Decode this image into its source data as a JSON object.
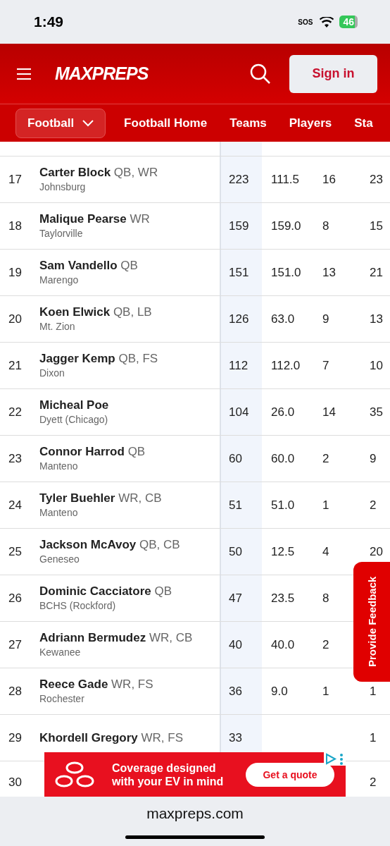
{
  "status_bar": {
    "time": "1:49",
    "sos": "SOS",
    "battery": "46"
  },
  "header": {
    "logo": "MAXPREPS",
    "sign_in": "Sign in"
  },
  "nav": {
    "sport": "Football",
    "links": [
      "Football Home",
      "Teams",
      "Players",
      "Sta"
    ]
  },
  "table": {
    "rows": [
      {
        "rank": "17",
        "name": "Carter Block",
        "positions": "QB, WR",
        "school": "Johnsburg",
        "column_1": "223",
        "column_2": "111.5",
        "column_3": "16",
        "column_4": "23"
      },
      {
        "rank": "18",
        "name": "Malique Pearse",
        "positions": "WR",
        "school": "Taylorville",
        "column_1": "159",
        "column_2": "159.0",
        "column_3": "8",
        "column_4": "15"
      },
      {
        "rank": "19",
        "name": "Sam Vandello",
        "positions": "QB",
        "school": "Marengo",
        "column_1": "151",
        "column_2": "151.0",
        "column_3": "13",
        "column_4": "21"
      },
      {
        "rank": "20",
        "name": "Koen Elwick",
        "positions": "QB, LB",
        "school": "Mt. Zion",
        "column_1": "126",
        "column_2": "63.0",
        "column_3": "9",
        "column_4": "13"
      },
      {
        "rank": "21",
        "name": "Jagger Kemp",
        "positions": "QB, FS",
        "school": "Dixon",
        "column_1": "112",
        "column_2": "112.0",
        "column_3": "7",
        "column_4": "10"
      },
      {
        "rank": "22",
        "name": "Micheal Poe",
        "positions": "",
        "school": "Dyett (Chicago)",
        "column_1": "104",
        "column_2": "26.0",
        "column_3": "14",
        "column_4": "35"
      },
      {
        "rank": "23",
        "name": "Connor Harrod",
        "positions": "QB",
        "school": "Manteno",
        "column_1": "60",
        "column_2": "60.0",
        "column_3": "2",
        "column_4": "9"
      },
      {
        "rank": "24",
        "name": "Tyler Buehler",
        "positions": "WR, CB",
        "school": "Manteno",
        "column_1": "51",
        "column_2": "51.0",
        "column_3": "1",
        "column_4": "2"
      },
      {
        "rank": "25",
        "name": "Jackson McAvoy",
        "positions": "QB, CB",
        "school": "Geneseo",
        "column_1": "50",
        "column_2": "12.5",
        "column_3": "4",
        "column_4": "20"
      },
      {
        "rank": "26",
        "name": "Dominic Cacciatore",
        "positions": "QB",
        "school": "BCHS (Rockford)",
        "column_1": "47",
        "column_2": "23.5",
        "column_3": "8"
      },
      {
        "rank": "27",
        "name": "Adriann Bermudez",
        "positions": "WR, CB",
        "school": "Kewanee",
        "column_1": "40",
        "column_2": "40.0",
        "column_3": "2"
      },
      {
        "rank": "28",
        "name": "Reece Gade",
        "positions": "WR, FS",
        "school": "Rochester",
        "column_1": "36",
        "column_2": "9.0",
        "column_3": "1",
        "column_4": "1"
      },
      {
        "rank": "29",
        "name": "Khordell Gregory",
        "positions": "WR, FS",
        "column_1": "33",
        "column_4": "1"
      },
      {
        "rank": "30",
        "column_4": "2"
      }
    ]
  },
  "feedback": {
    "label": "Provide Feedback"
  },
  "ad": {
    "text": "Coverage designed with your EV in mind",
    "button": "Get a quote"
  },
  "browser": {
    "url": "maxpreps.com"
  }
}
